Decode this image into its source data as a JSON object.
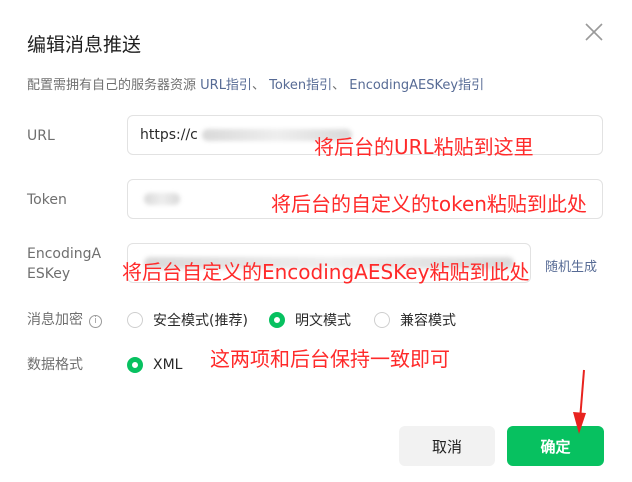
{
  "dialog": {
    "title": "编辑消息推送",
    "description_prefix": "配置需拥有自己的服务器资源 ",
    "links": [
      "URL指引",
      "Token指引",
      "EncodingAESKey指引"
    ],
    "link_separator": "、"
  },
  "form": {
    "url": {
      "label": "URL",
      "value": "https://c"
    },
    "token": {
      "label": "Token",
      "value": ""
    },
    "aeskey": {
      "label": "EncodingAESKey",
      "value": "",
      "generate_label": "随机生成"
    },
    "encrypt": {
      "label": "消息加密",
      "help_icon": "info-circle-icon",
      "options": [
        {
          "label": "安全模式(推荐)",
          "checked": false
        },
        {
          "label": "明文模式",
          "checked": true
        },
        {
          "label": "兼容模式",
          "checked": false
        }
      ]
    },
    "format": {
      "label": "数据格式",
      "options": [
        {
          "label": "XML",
          "checked": true
        }
      ]
    }
  },
  "annotations": {
    "url": "将后台的URL粘贴到这里",
    "token": "将后台的自定义的token粘贴到此处",
    "aeskey": "将后台自定义的EncodingAESKey粘贴到此处",
    "consistency": "这两项和后台保持一致即可"
  },
  "buttons": {
    "cancel": "取消",
    "confirm": "确定"
  },
  "colors": {
    "primary": "#07c160",
    "link": "#576b95",
    "annotation": "#ff2a2a"
  }
}
